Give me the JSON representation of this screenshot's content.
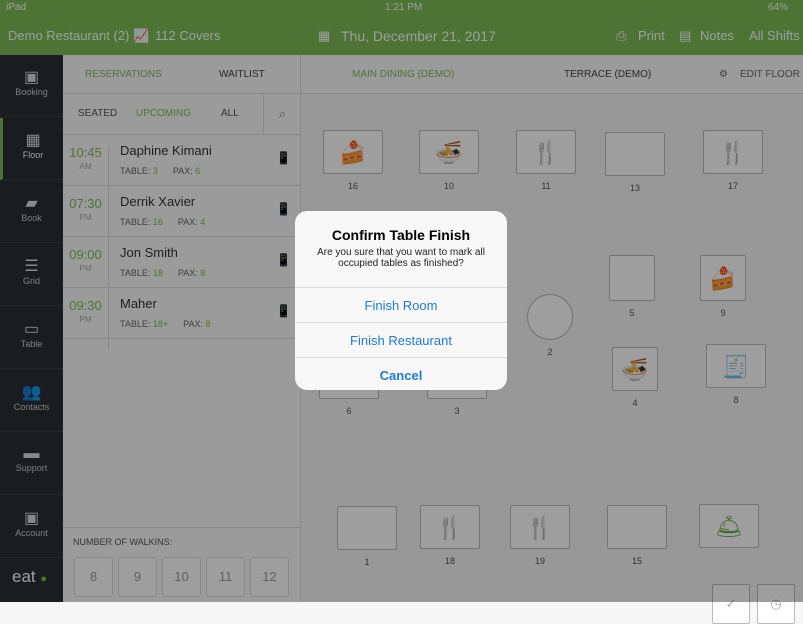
{
  "status_bar": {
    "device": "iPad",
    "time": "1:21 PM",
    "battery": "64%"
  },
  "header": {
    "restaurant": "Demo Restaurant (2)",
    "covers": "112 Covers",
    "date": "Thu, December 21, 2017",
    "print": "Print",
    "notes": "Notes",
    "shifts": "All Shifts"
  },
  "sidebar": {
    "items": [
      {
        "label": "Booking",
        "icon": "calendar-icon"
      },
      {
        "label": "Floor",
        "icon": "grid-icon",
        "active": true
      },
      {
        "label": "Book",
        "icon": "book-icon"
      },
      {
        "label": "Grid",
        "icon": "list-icon"
      },
      {
        "label": "Table",
        "icon": "table-icon"
      },
      {
        "label": "Contacts",
        "icon": "contacts-icon"
      },
      {
        "label": "Support",
        "icon": "chat-icon"
      },
      {
        "label": "Account",
        "icon": "account-icon"
      }
    ],
    "logo": "eat"
  },
  "left": {
    "tabs": [
      "RESERVATIONS",
      "WAITLIST"
    ],
    "filters": [
      "SEATED",
      "UPCOMING",
      "ALL"
    ],
    "reservations": [
      {
        "time": "10:45",
        "ampm": "AM",
        "name": "Daphine Kimani",
        "table": "3",
        "pax": "6"
      },
      {
        "time": "07:30",
        "ampm": "PM",
        "name": "Derrik Xavier",
        "table": "16",
        "pax": "4"
      },
      {
        "time": "09:00",
        "ampm": "PM",
        "name": "Jon Smith",
        "table": "18",
        "pax": "8"
      },
      {
        "time": "09:30",
        "ampm": "PM",
        "name": "Maher",
        "table": "18+",
        "pax": "8"
      }
    ],
    "table_label": "TABLE:",
    "pax_label": "PAX:",
    "walkins_label": "NUMBER OF WALKINS:",
    "walkins": [
      "8",
      "9",
      "10",
      "11",
      "12"
    ]
  },
  "floor": {
    "tabs": [
      "MAIN DINING (DEMO)",
      "TERRACE (DEMO)"
    ],
    "edit": "EDIT FLOOR",
    "tables": [
      "16",
      "10",
      "11",
      "13",
      "17",
      "5",
      "9",
      "2",
      "4",
      "8",
      "6",
      "3",
      "1",
      "18",
      "19",
      "15"
    ]
  },
  "dialog": {
    "title": "Confirm Table Finish",
    "message": "Are you sure that you want to mark all occupied tables as finished?",
    "buttons": [
      "Finish Room",
      "Finish Restaurant",
      "Cancel"
    ]
  },
  "colors": {
    "accent": "#7cbc55",
    "link": "#1f7ad6"
  }
}
